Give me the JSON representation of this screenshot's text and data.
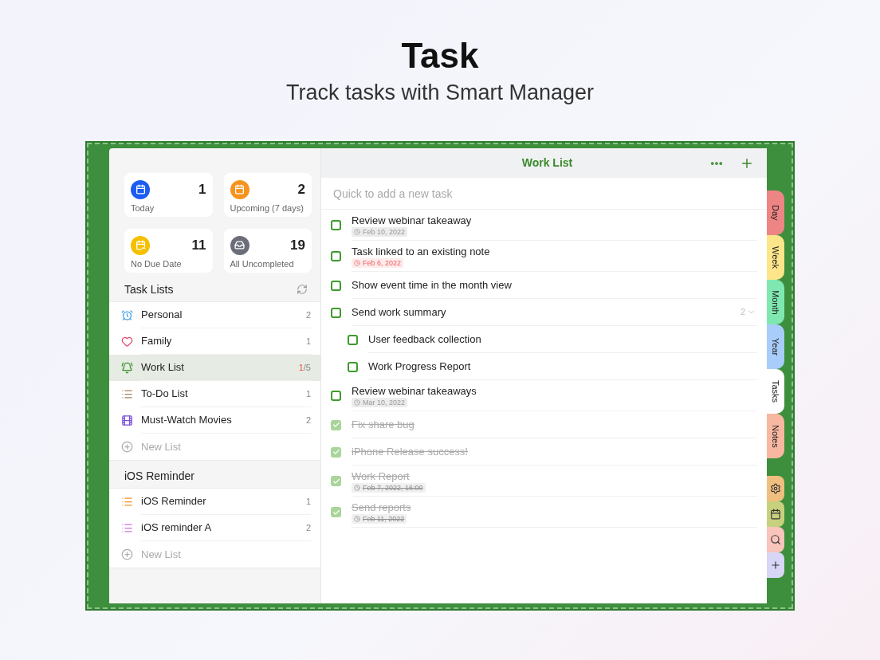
{
  "hero": {
    "title": "Task",
    "subtitle": "Track tasks with Smart Manager"
  },
  "summary_cards": [
    {
      "kind": "today",
      "label": "Today",
      "count": "1",
      "color": "#1b5cf2"
    },
    {
      "kind": "upcoming",
      "label": "Upcoming (7 days)",
      "count": "2",
      "color": "#f7931e"
    },
    {
      "kind": "no_date",
      "label": "No Due Date",
      "count": "11",
      "color": "#f5c000"
    },
    {
      "kind": "all",
      "label": "All Uncompleted",
      "count": "19",
      "color": "#6b6e78"
    }
  ],
  "sections": [
    {
      "title": "Task Lists",
      "sync_button": true,
      "new_list": "New List",
      "items": [
        {
          "kind": "alarm",
          "name": "Personal",
          "count": "2",
          "selected": false
        },
        {
          "kind": "heart",
          "name": "Family",
          "count": "1",
          "selected": false
        },
        {
          "kind": "bell",
          "name": "Work List",
          "overdue": "1",
          "count": "/5",
          "selected": true
        },
        {
          "kind": "list_brown",
          "name": "To-Do List",
          "count": "1",
          "selected": false
        },
        {
          "kind": "film",
          "name": "Must-Watch Movies",
          "count": "2",
          "selected": false
        }
      ]
    },
    {
      "title": "iOS Reminder",
      "sync_button": false,
      "new_list": "New List",
      "items": [
        {
          "kind": "list_orange",
          "name": "iOS Reminder",
          "count": "1",
          "selected": false
        },
        {
          "kind": "list_purple",
          "name": "iOS reminder A",
          "count": "2",
          "selected": false
        }
      ]
    }
  ],
  "main": {
    "title": "Work List",
    "quick_add": {
      "placeholder": "Quick to add a new task"
    },
    "tasks": [
      {
        "title": "Review webinar takeaway",
        "done": false,
        "date": "Feb 10, 2022",
        "overdue": false
      },
      {
        "title": "Task linked to an existing note",
        "done": false,
        "date": "Feb 6, 2022",
        "overdue": true
      },
      {
        "title": "Show event time in the month view",
        "done": false
      },
      {
        "title": "Send work summary",
        "done": false,
        "subtask_count": "2",
        "expanded": true,
        "children": [
          {
            "title": "User feedback collection",
            "done": false
          },
          {
            "title": "Work Progress Report",
            "done": false
          }
        ]
      },
      {
        "title": "Review webinar takeaways",
        "done": false,
        "date": "Mar 10, 2022",
        "overdue": false
      },
      {
        "title": "Fix share bug",
        "done": true
      },
      {
        "title": "iPhone Release success!",
        "done": true
      },
      {
        "title": "Work Report",
        "done": true,
        "date": "Feb 7, 2022, 16:00",
        "overdue": false
      },
      {
        "title": "Send reports",
        "done": true,
        "date": "Feb 11, 2022",
        "overdue": false
      }
    ]
  },
  "side_tabs": [
    {
      "label": "Day",
      "color": "#ee8585",
      "selected": false
    },
    {
      "label": "Week",
      "color": "#fde68a",
      "selected": false
    },
    {
      "label": "Month",
      "color": "#7fe8b0",
      "selected": false
    },
    {
      "label": "Year",
      "color": "#a8cdfb",
      "selected": false
    },
    {
      "label": "Tasks",
      "color": "#ffffff",
      "selected": true
    },
    {
      "label": "Notes",
      "color": "#f8b7a0",
      "selected": false
    }
  ],
  "tool_tabs": [
    {
      "kind": "settings",
      "color": "#f0bf80"
    },
    {
      "kind": "calendar",
      "color": "#c7d17d"
    },
    {
      "kind": "search",
      "color": "#f8c4bc"
    },
    {
      "kind": "add",
      "color": "#d8d6f6"
    }
  ]
}
